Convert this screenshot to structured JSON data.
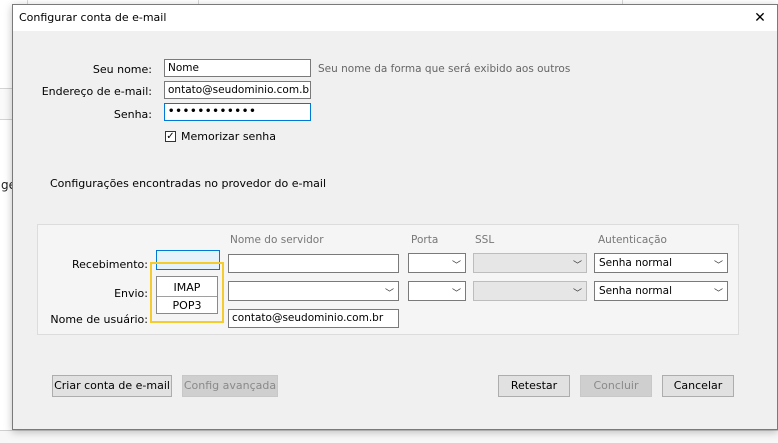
{
  "background": {
    "left_fragment": "ge"
  },
  "dialog": {
    "title": "Configurar conta de e-mail",
    "close_glyph": "✕"
  },
  "form": {
    "name_label": "Seu nome:",
    "name_value": "Nome",
    "name_hint": "Seu nome da forma que será exibido aos outros",
    "email_label": "Endereço de e-mail:",
    "email_value": "ontato@seudominio.com.br",
    "password_label": "Senha:",
    "password_value": "••••••••••••",
    "remember_label": "Memorizar senha",
    "remember_checked": true
  },
  "provider": {
    "section_title": "Configurações encontradas no provedor do e-mail"
  },
  "server_table": {
    "headers": {
      "server": "Nome do servidor",
      "port": "Porta",
      "ssl": "SSL",
      "auth": "Autenticação"
    },
    "incoming_label": "Recebimento:",
    "outgoing_label": "Envio:",
    "username_label": "Nome de usuário:",
    "username_value": "contato@seudominio.com.br",
    "incoming_auth": "Senha normal",
    "outgoing_auth": "Senha normal",
    "protocol_options": [
      "IMAP",
      "POP3"
    ]
  },
  "buttons": {
    "create": "Criar conta de e-mail",
    "advanced": "Config avançada",
    "retest": "Retestar",
    "done": "Concluir",
    "cancel": "Cancelar"
  },
  "colors": {
    "highlight": "#f5cc2e",
    "focus": "#0078d7"
  }
}
